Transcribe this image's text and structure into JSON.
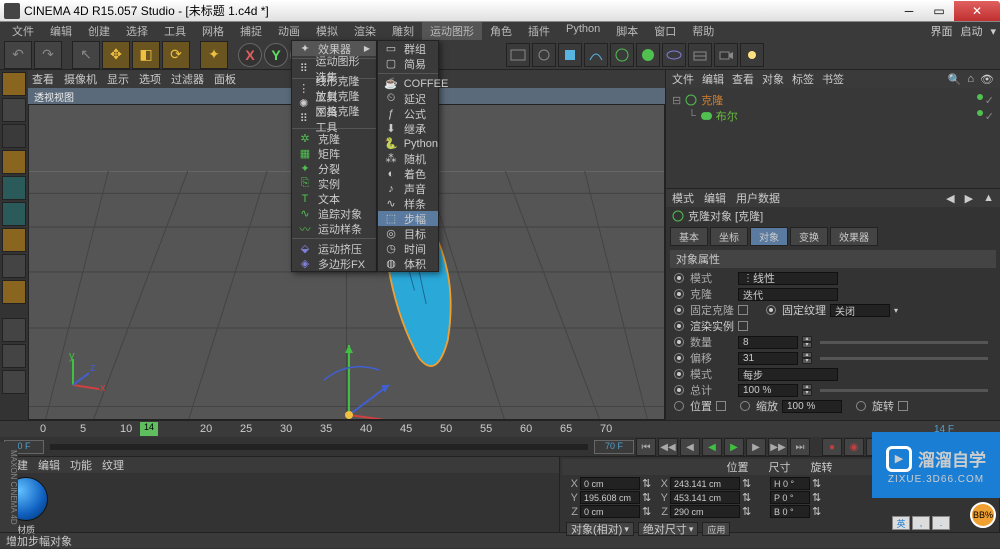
{
  "title": "CINEMA 4D R15.057 Studio - [未标题 1.c4d *]",
  "menubar": [
    "文件",
    "编辑",
    "创建",
    "选择",
    "工具",
    "网格",
    "捕捉",
    "动画",
    "模拟",
    "渲染",
    "雕刻",
    "运动图形",
    "角色",
    "插件",
    "Python",
    "脚本",
    "窗口",
    "帮助"
  ],
  "menu_active_index": 11,
  "menuright": {
    "layout": "界面",
    "startup": "启动"
  },
  "axes": [
    "X",
    "Y",
    "Z"
  ],
  "dd1": {
    "header": "效果器",
    "items": [
      "运动图形选集",
      "线形克隆工具",
      "放射克隆工具",
      "网格克隆工具",
      "克隆",
      "矩阵",
      "分裂",
      "实例",
      "文本",
      "追踪对象",
      "运动样条",
      "运动挤压",
      "多边形FX"
    ]
  },
  "dd2": {
    "items": [
      "群组",
      "简易",
      "COFFEE",
      "延迟",
      "公式",
      "继承",
      "Python",
      "随机",
      "着色",
      "声音",
      "样条",
      "步幅",
      "目标",
      "时间",
      "体积"
    ],
    "highlight_index": 11
  },
  "viewport": {
    "tabs": [
      "查看",
      "摄像机",
      "显示",
      "选项",
      "过滤器",
      "面板"
    ],
    "title": "透视视图"
  },
  "rightpanel": {
    "tabs": [
      "文件",
      "编辑",
      "查看",
      "对象",
      "标签",
      "书签"
    ],
    "tree": [
      {
        "label": "克隆",
        "selected": true
      },
      {
        "label": "布尔",
        "selected": false,
        "indent": true
      }
    ]
  },
  "attr": {
    "tabs": [
      "模式",
      "编辑",
      "用户数据"
    ],
    "head": "克隆对象 [克隆]",
    "subtabs": [
      "基本",
      "坐标",
      "对象",
      "变换",
      "效果器"
    ],
    "active_subtab": 2,
    "section": "对象属性",
    "rows": {
      "mode_label": "模式",
      "mode_val": "线性",
      "clone_label": "克隆",
      "clone_val": "迭代",
      "fix_clone": "固定克隆",
      "fix_tex": "固定纹理",
      "fix_tex_val": "关闭",
      "render_inst": "渲染实例",
      "count_label": "数量",
      "count_val": "8",
      "offset_label": "偏移",
      "offset_val": "31",
      "mode2_label": "模式",
      "mode2_val": "每步",
      "total_label": "总计",
      "total_val": "100 %",
      "pos_label": "位置",
      "rot_label": "旋转",
      "scale_label": "缩放",
      "scale_val": "100 %"
    }
  },
  "timeline": {
    "start": "0 F",
    "end": "70 F",
    "current": "14",
    "frame_display": "14 F",
    "ticks": [
      "0",
      "5",
      "10",
      "14",
      "20",
      "25",
      "30",
      "35",
      "40",
      "45",
      "50",
      "55",
      "60",
      "65",
      "70"
    ]
  },
  "material": {
    "tabs": [
      "创建",
      "编辑",
      "功能",
      "纹理"
    ],
    "name": "材质"
  },
  "coord": {
    "tabs": [
      "位置",
      "尺寸",
      "旋转"
    ],
    "rows": [
      {
        "axis": "X",
        "pos": "0 cm",
        "size": "243.141 cm",
        "rot": "H 0 °"
      },
      {
        "axis": "Y",
        "pos": "195.608 cm",
        "size": "453.141 cm",
        "rot": "P 0 °"
      },
      {
        "axis": "Z",
        "pos": "0 cm",
        "size": "290 cm",
        "rot": "B 0 °"
      }
    ],
    "dd1": "对象(相对)",
    "dd2": "绝对尺寸",
    "apply": "应用"
  },
  "status": "增加步幅对象",
  "watermark": {
    "brand": "溜溜自学",
    "sub": "ZIXUE.3D66.COM"
  },
  "bubble": "BB%",
  "lang": [
    "英",
    ",",
    "."
  ]
}
